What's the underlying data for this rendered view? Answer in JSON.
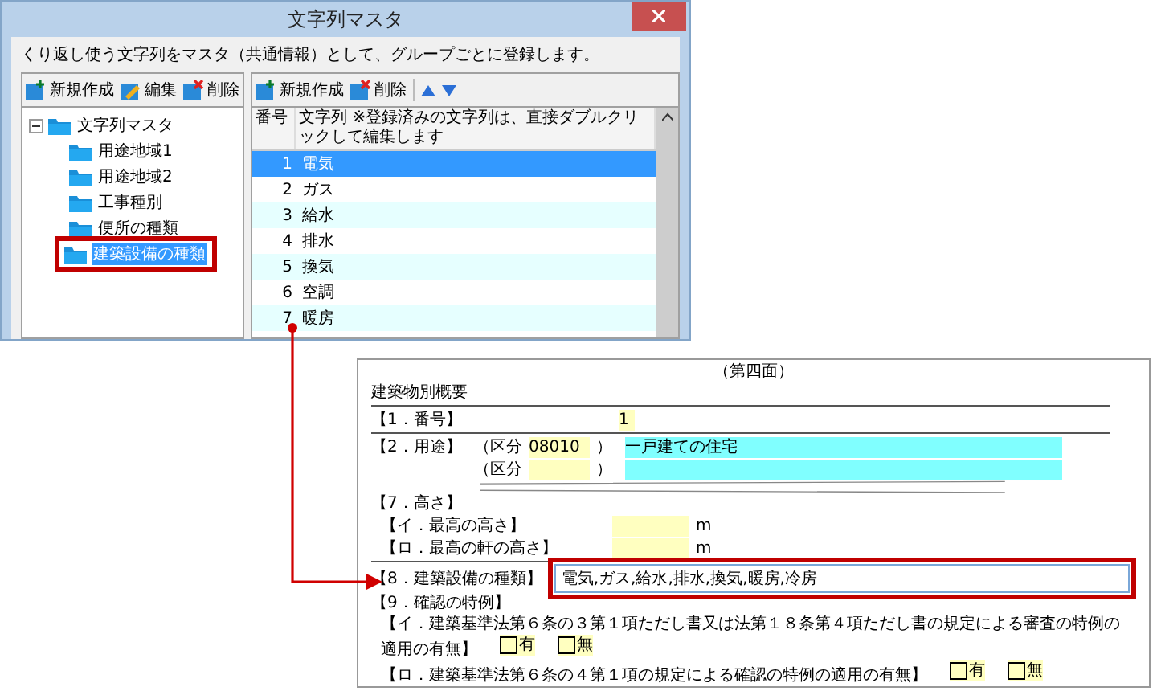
{
  "dialog": {
    "title": "文字列マスタ",
    "description": "くり返し使う文字列をマスタ（共通情報）として、グループごとに登録します。",
    "group_toolbar": [
      {
        "kind": "new",
        "label": "新規作成"
      },
      {
        "kind": "edit",
        "label": "編集"
      },
      {
        "kind": "delete",
        "label": "削除"
      }
    ],
    "tree": {
      "label": "文字列マスタ",
      "expanded": true,
      "children": [
        {
          "label": "用途地域1",
          "selected": false
        },
        {
          "label": "用途地域2",
          "selected": false
        },
        {
          "label": "工事種別",
          "selected": false
        },
        {
          "label": "便所の種類",
          "selected": false
        },
        {
          "label": "建築設備の種類",
          "selected": true
        }
      ]
    },
    "string_toolbar": [
      {
        "kind": "new",
        "label": "新規作成"
      },
      {
        "kind": "delete",
        "label": "削除"
      }
    ],
    "table": {
      "columns": [
        {
          "label": "番号"
        },
        {
          "label": "文字列",
          "note": "※登録済みの文字列は、直接ダブルクリックして編集します"
        }
      ],
      "rows": [
        {
          "number": "1",
          "text": "電気",
          "selected": true
        },
        {
          "number": "2",
          "text": "ガス",
          "selected": false
        },
        {
          "number": "3",
          "text": "給水",
          "selected": false
        },
        {
          "number": "4",
          "text": "排水",
          "selected": false
        },
        {
          "number": "5",
          "text": "換気",
          "selected": false
        },
        {
          "number": "6",
          "text": "空調",
          "selected": false
        },
        {
          "number": "7",
          "text": "暖房",
          "selected": false
        }
      ]
    }
  },
  "form": {
    "page_label": "（第四面）",
    "heading": "建築物別概要",
    "item_1": {
      "label": "【1．番号】",
      "value": "1"
    },
    "item_2": {
      "label": "【2．用途】",
      "rows": [
        {
          "prefix": "（区分",
          "code": "08010",
          "close": "）",
          "value": "一戸建ての住宅"
        },
        {
          "prefix": "（区分",
          "close": "）"
        }
      ]
    },
    "item_7": {
      "label": "【7．高さ】",
      "rows": [
        {
          "label": "【イ．最高の高さ】",
          "unit": "m"
        },
        {
          "label": "【ロ．最高の軒の高さ】",
          "unit": "m"
        }
      ]
    },
    "item_8": {
      "label": "【8．建築設備の種類】",
      "value": "電気,ガス,給水,排水,換気,暖房,冷房"
    },
    "item_9": {
      "label": "【9．確認の特例】",
      "questions": [
        {
          "text": "【イ．建築基準法第６条の３第１項ただし書又は法第１８条第４項ただし書の規定による審査の特例の適用の有無】",
          "options": [
            {
              "label": "有",
              "checked": false
            },
            {
              "label": "無",
              "checked": false
            }
          ]
        },
        {
          "text": "【ロ．建築基準法第６条の４第１項の規定による確認の特例の適用の有無】",
          "options": [
            {
              "label": "有",
              "checked": false
            },
            {
              "label": "無",
              "checked": false
            }
          ]
        }
      ]
    }
  }
}
